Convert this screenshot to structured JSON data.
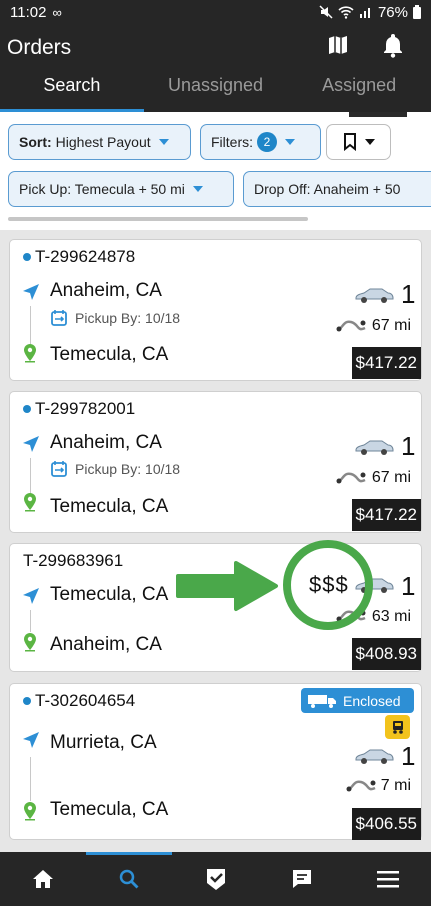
{
  "status_bar": {
    "time": "11:02",
    "battery": "76%"
  },
  "header": {
    "title": "Orders"
  },
  "tabs": [
    {
      "label": "Search",
      "active": true
    },
    {
      "label": "Unassigned",
      "active": false
    },
    {
      "label": "Assigned",
      "active": false
    }
  ],
  "filters": {
    "sort_label": "Sort:",
    "sort_value": "Highest Payout",
    "filters_label": "Filters:",
    "filters_count": "2",
    "pickup_chip": "Pick Up: Temecula + 50 mi",
    "dropoff_chip": "Drop Off: Anaheim + 50"
  },
  "orders": [
    {
      "id": "T-299624878",
      "origin": "Anaheim, CA",
      "pickup_by": "Pickup By: 10/18",
      "destination": "Temecula, CA",
      "vehicles": "1",
      "distance": "67 mi",
      "price": "$417.22"
    },
    {
      "id": "T-299782001",
      "origin": "Anaheim, CA",
      "pickup_by": "Pickup By: 10/18",
      "destination": "Temecula, CA",
      "vehicles": "1",
      "distance": "67 mi",
      "price": "$417.22"
    },
    {
      "id": "T-299683961",
      "origin": "Temecula, CA",
      "destination": "Anaheim, CA",
      "vehicles": "1",
      "distance": "63 mi",
      "price": "$408.93"
    },
    {
      "id": "T-302604654",
      "origin": "Murrieta, CA",
      "destination": "Temecula, CA",
      "vehicles": "1",
      "distance": "7 mi",
      "price": "$406.55",
      "badge": "Enclosed"
    }
  ],
  "annotation": {
    "text": "$$$",
    "color": "#4aa84a"
  },
  "colors": {
    "accent": "#2d8fd5",
    "header_bg": "#262626",
    "pin_green": "#5bb543"
  },
  "bottom_nav": [
    "home-icon",
    "search-icon",
    "check-shield-icon",
    "chat-icon",
    "menu-icon"
  ]
}
